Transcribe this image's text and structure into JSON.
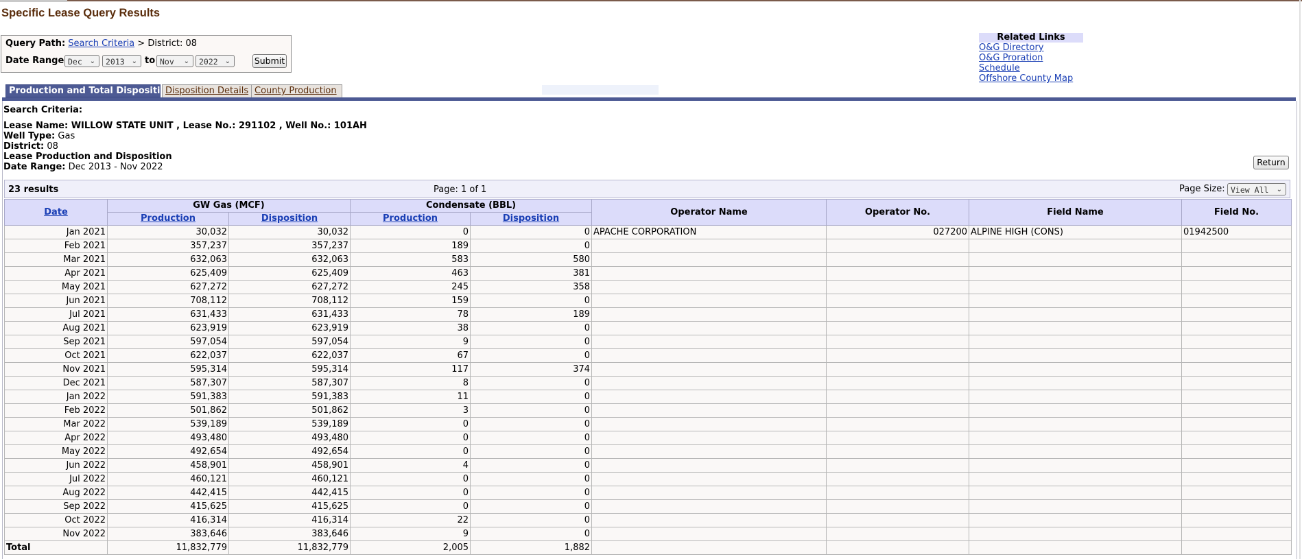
{
  "page": {
    "title": "Specific Lease Query Results"
  },
  "query": {
    "path_label": "Query Path:",
    "path_link": "Search Criteria",
    "path_rest": "> District: 08",
    "date_range_label": "Date Range:",
    "from_month": "Dec",
    "from_year": "2013",
    "to_label": "to",
    "to_month": "Nov",
    "to_year": "2022",
    "submit_label": "Submit"
  },
  "related_links": {
    "title": "Related Links",
    "links": [
      "O&G Directory",
      "O&G Proration Schedule",
      "Offshore County Map"
    ]
  },
  "tabs": [
    {
      "label": "Production and Total Disposition",
      "active": true
    },
    {
      "label": "Disposition Details",
      "active": false
    },
    {
      "label": "County Production",
      "active": false
    }
  ],
  "criteria": {
    "heading": "Search Criteria:",
    "lease_line": "Lease Name: WILLOW STATE UNIT , Lease No.: 291102 , Well No.: 101AH",
    "well_type_label": "Well Type:",
    "well_type": "Gas",
    "district_label": "District:",
    "district": "08",
    "section_title": "Lease Production and Disposition",
    "date_range_label": "Date Range:",
    "date_range": "Dec 2013 - Nov 2022",
    "return_label": "Return"
  },
  "results": {
    "count": "23 results",
    "page_info": "Page: 1 of 1",
    "page_size_label": "Page Size:",
    "page_size_value": "View All"
  },
  "table": {
    "headers": {
      "date": "Date",
      "gw_gas": "GW Gas (MCF)",
      "condensate": "Condensate (BBL)",
      "production": "Production",
      "disposition": "Disposition",
      "operator_name": "Operator Name",
      "operator_no": "Operator No.",
      "field_name": "Field Name",
      "field_no": "Field No."
    },
    "rows": [
      [
        "Jan 2021",
        "30,032",
        "30,032",
        "0",
        "0",
        "APACHE CORPORATION",
        "027200",
        "ALPINE HIGH (CONS)",
        "01942500"
      ],
      [
        "Feb 2021",
        "357,237",
        "357,237",
        "189",
        "0",
        "",
        "",
        "",
        ""
      ],
      [
        "Mar 2021",
        "632,063",
        "632,063",
        "583",
        "580",
        "",
        "",
        "",
        ""
      ],
      [
        "Apr 2021",
        "625,409",
        "625,409",
        "463",
        "381",
        "",
        "",
        "",
        ""
      ],
      [
        "May 2021",
        "627,272",
        "627,272",
        "245",
        "358",
        "",
        "",
        "",
        ""
      ],
      [
        "Jun 2021",
        "708,112",
        "708,112",
        "159",
        "0",
        "",
        "",
        "",
        ""
      ],
      [
        "Jul 2021",
        "631,433",
        "631,433",
        "78",
        "189",
        "",
        "",
        "",
        ""
      ],
      [
        "Aug 2021",
        "623,919",
        "623,919",
        "38",
        "0",
        "",
        "",
        "",
        ""
      ],
      [
        "Sep 2021",
        "597,054",
        "597,054",
        "9",
        "0",
        "",
        "",
        "",
        ""
      ],
      [
        "Oct 2021",
        "622,037",
        "622,037",
        "67",
        "0",
        "",
        "",
        "",
        ""
      ],
      [
        "Nov 2021",
        "595,314",
        "595,314",
        "117",
        "374",
        "",
        "",
        "",
        ""
      ],
      [
        "Dec 2021",
        "587,307",
        "587,307",
        "8",
        "0",
        "",
        "",
        "",
        ""
      ],
      [
        "Jan 2022",
        "591,383",
        "591,383",
        "11",
        "0",
        "",
        "",
        "",
        ""
      ],
      [
        "Feb 2022",
        "501,862",
        "501,862",
        "3",
        "0",
        "",
        "",
        "",
        ""
      ],
      [
        "Mar 2022",
        "539,189",
        "539,189",
        "0",
        "0",
        "",
        "",
        "",
        ""
      ],
      [
        "Apr 2022",
        "493,480",
        "493,480",
        "0",
        "0",
        "",
        "",
        "",
        ""
      ],
      [
        "May 2022",
        "492,654",
        "492,654",
        "0",
        "0",
        "",
        "",
        "",
        ""
      ],
      [
        "Jun 2022",
        "458,901",
        "458,901",
        "4",
        "0",
        "",
        "",
        "",
        ""
      ],
      [
        "Jul 2022",
        "460,121",
        "460,121",
        "0",
        "0",
        "",
        "",
        "",
        ""
      ],
      [
        "Aug 2022",
        "442,415",
        "442,415",
        "0",
        "0",
        "",
        "",
        "",
        ""
      ],
      [
        "Sep 2022",
        "415,625",
        "415,625",
        "0",
        "0",
        "",
        "",
        "",
        ""
      ],
      [
        "Oct 2022",
        "416,314",
        "416,314",
        "22",
        "0",
        "",
        "",
        "",
        ""
      ],
      [
        "Nov 2022",
        "383,646",
        "383,646",
        "9",
        "0",
        "",
        "",
        "",
        ""
      ]
    ],
    "total": [
      "Total",
      "11,832,779",
      "11,832,779",
      "2,005",
      "1,882",
      "",
      "",
      "",
      ""
    ]
  },
  "colors": {
    "title_brown": "#5a2d0c",
    "header_lavender": "#dcdcfa",
    "tab_active": "#4d5a94",
    "link_blue": "#1a3fb5"
  }
}
